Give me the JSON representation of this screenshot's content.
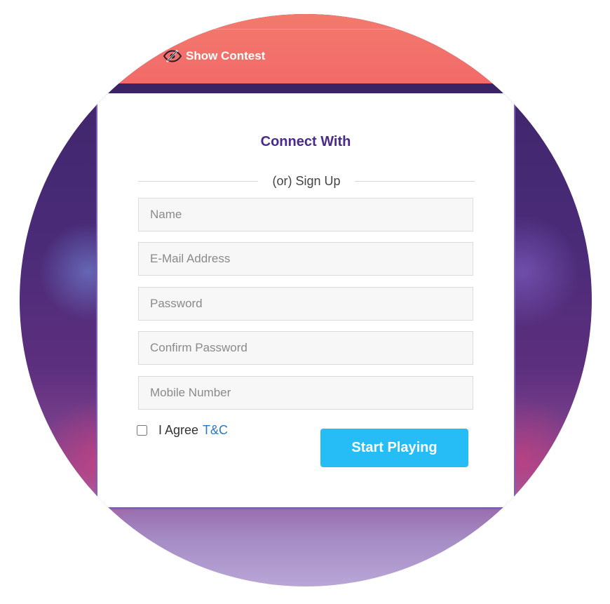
{
  "header": {
    "brand_label": "Show Contest",
    "brand_icon": "eye-slash-icon"
  },
  "form": {
    "title": "Connect With",
    "divider_text": "(or) Sign Up",
    "fields": [
      {
        "placeholder": "Name",
        "value": ""
      },
      {
        "placeholder": "E-Mail Address",
        "value": ""
      },
      {
        "placeholder": "Password",
        "value": ""
      },
      {
        "placeholder": "Confirm Password",
        "value": ""
      },
      {
        "placeholder": "Mobile Number",
        "value": ""
      }
    ],
    "agree_label": "I Agree",
    "agree_link": "T&C",
    "agree_checked": false,
    "submit_label": "Start Playing"
  },
  "colors": {
    "header_bg": "#f26a6a",
    "title_color": "#4a2a8c",
    "link_color": "#2a78c0",
    "button_bg": "#26bdf6",
    "card_border": "#7c5ec4"
  }
}
